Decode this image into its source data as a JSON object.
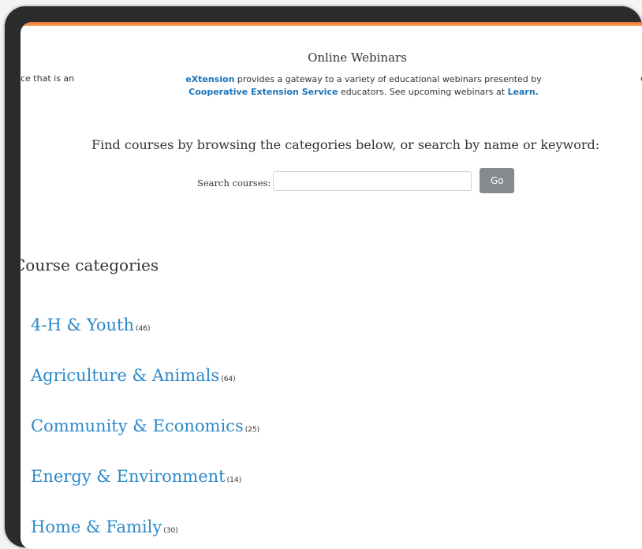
{
  "webinar": {
    "title": "Online Webinars",
    "left_fragment": "ce that is an",
    "right_fragment": "e",
    "desc_brand": "eXtension",
    "desc_text1": " provides a gateway to a variety of educational webinars presented by",
    "desc_link2": "Cooperative Extension Service",
    "desc_text2": " educators.  See upcoming webinars at ",
    "desc_link3": "Learn."
  },
  "search": {
    "prompt": "Find courses by browsing the categories below, or search by name or keyword:",
    "label": "Search courses:",
    "input_value": "",
    "button_label": "Go"
  },
  "categories": {
    "heading": "Course categories",
    "items": [
      {
        "name": "4-H & Youth",
        "count": "(46)"
      },
      {
        "name": "Agriculture & Animals",
        "count": "(64)"
      },
      {
        "name": "Community & Economics",
        "count": "(25)"
      },
      {
        "name": "Energy & Environment",
        "count": "(14)"
      },
      {
        "name": "Home & Family",
        "count": "(30)"
      }
    ]
  },
  "colors": {
    "accent": "#e8732a",
    "link": "#2c8ac9",
    "button": "#858a8f",
    "frame": "#2b2b2b"
  }
}
